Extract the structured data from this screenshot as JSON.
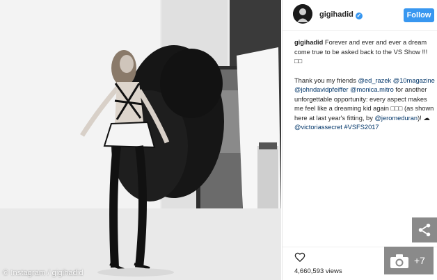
{
  "photo": {
    "credit": "© Instagram / gigihadid"
  },
  "header": {
    "username": "gigihadid",
    "verified_mark": "✓",
    "follow_label": "Follow"
  },
  "caption": {
    "username": "gigihadid",
    "line1": "Forever and ever and ever a dream come true to be asked back to the VS Show !!!",
    "emoji1": "□□",
    "thanks": "Thank you my friends",
    "mention1": "@ed_razek",
    "mention2": "@10magazine",
    "mention3": "@johndavidpfeiffer",
    "mention4": "@monica.mitro",
    "text2": "for another unforgettable opportunity: every aspect makes me feel like a dreaming kid again",
    "emoji2": "□□□",
    "text3": "(as shown here at last year's fitting, by",
    "mention5": "@jeromeduran",
    "text4": ")! ☁",
    "mention6": "@victoriassecret",
    "hashtag": "#VSFS2017"
  },
  "footer": {
    "views": "4,660,593 views"
  },
  "overlays": {
    "gallery_count": "+7"
  },
  "icons": {
    "heart": "heart-icon",
    "share": "share-icon",
    "camera": "camera-icon",
    "verified": "verified-badge-icon"
  },
  "colors": {
    "accent": "#3897f0",
    "mention": "#003569",
    "text": "#262626",
    "overlay_gray": "#8a8a8a"
  }
}
